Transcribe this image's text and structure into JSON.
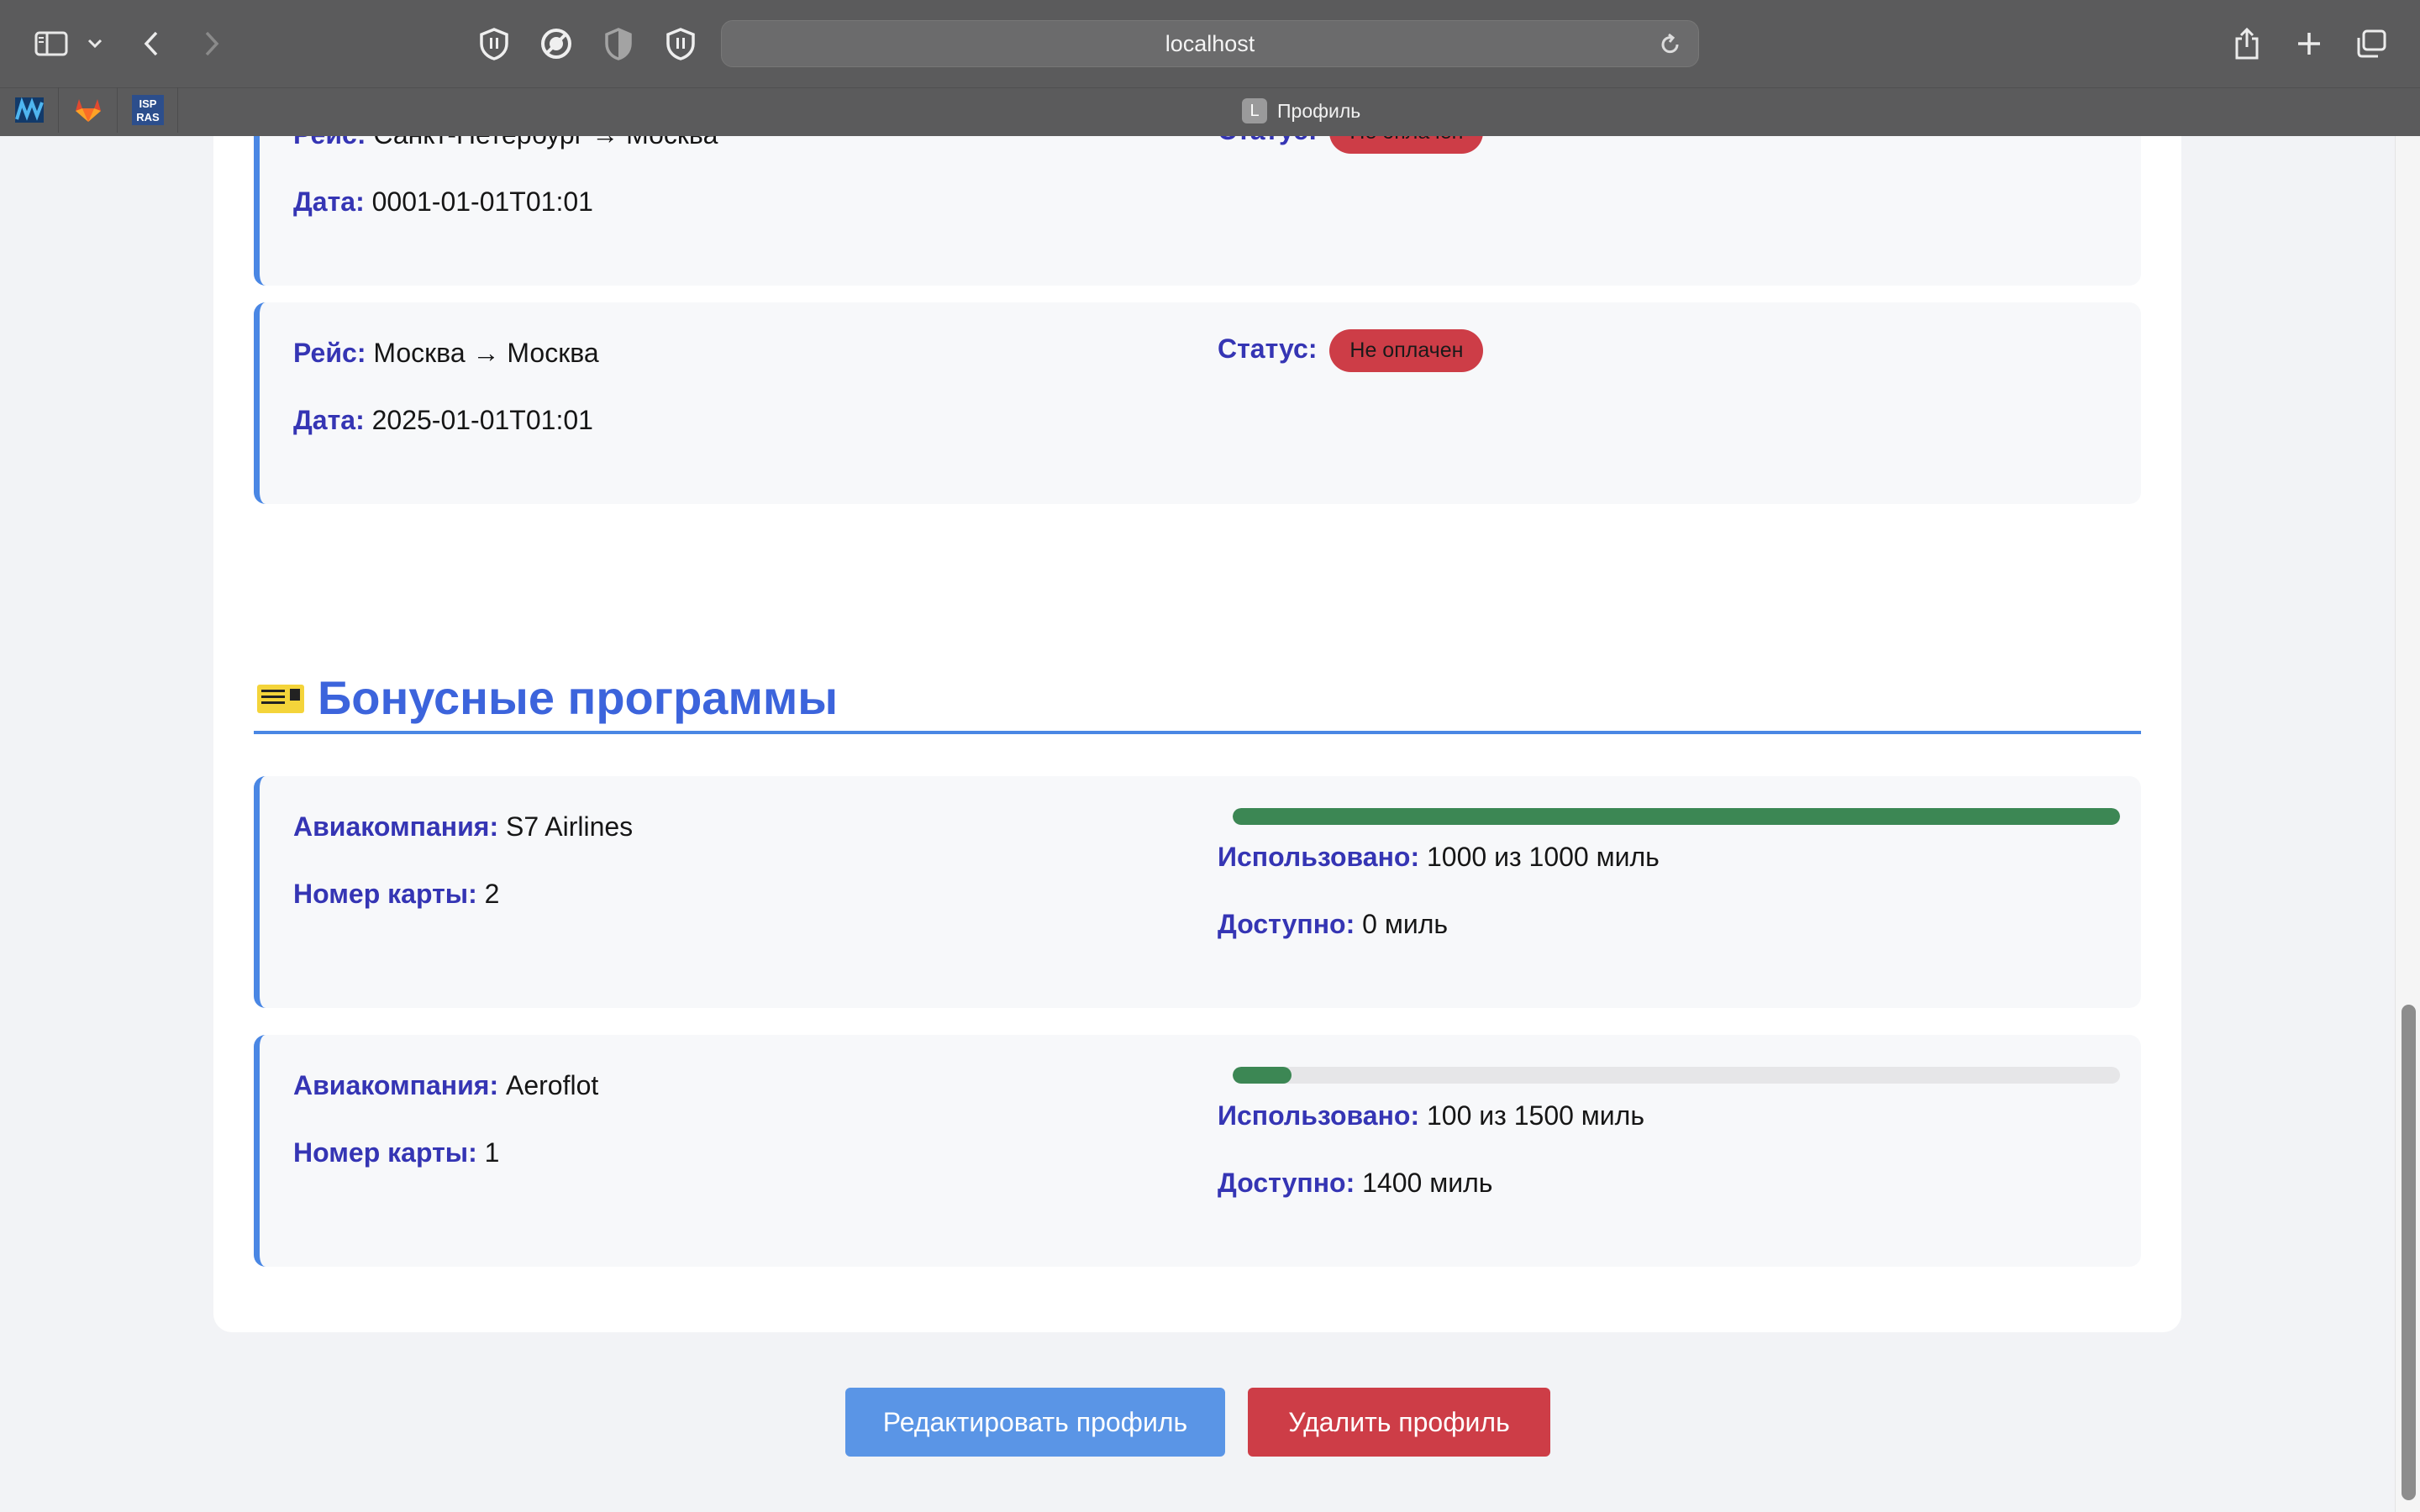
{
  "browser": {
    "url": "localhost",
    "tab_title": "Профиль",
    "tab_favicon_letter": "L",
    "icons": [
      "sidebar-icon",
      "chevron-down-icon",
      "back-icon",
      "forward-icon",
      "shield-icon",
      "block-icon",
      "half-shield-icon",
      "shield-icon",
      "reload-icon",
      "share-icon",
      "plus-icon",
      "tabs-icon"
    ],
    "bookmarks": [
      "bookmark-waves",
      "bookmark-gitlab",
      "bookmark-isp-ras"
    ]
  },
  "flights": {
    "route_label": "Рейс:",
    "date_label": "Дата:",
    "status_label": "Статус:",
    "items": [
      {
        "route": "Санкт-Петербург → Москва",
        "date": "0001-01-01T01:01",
        "status": "Не оплачен"
      },
      {
        "route": "Москва → Москва",
        "date": "2025-01-01T01:01",
        "status": "Не оплачен"
      }
    ]
  },
  "bonus": {
    "title": "Бонусные программы",
    "airline_label": "Авиакомпания:",
    "card_label": "Номер карты:",
    "used_label": "Использовано:",
    "available_label": "Доступно:",
    "programs": [
      {
        "airline": "S7 Airlines",
        "card_number": "2",
        "used_text": "1000 из 1000 миль",
        "available_text": "0 миль",
        "used_fraction": 1.0
      },
      {
        "airline": "Aeroflot",
        "card_number": "1",
        "used_text": "100 из 1500 миль",
        "available_text": "1400 миль",
        "used_fraction": 0.0667
      }
    ],
    "progress_color": "#3c8754"
  },
  "actions": {
    "edit_label": "Редактировать профиль",
    "delete_label": "Удалить профиль",
    "edit_color": "#5a95e6",
    "delete_color": "#cd3d47"
  }
}
